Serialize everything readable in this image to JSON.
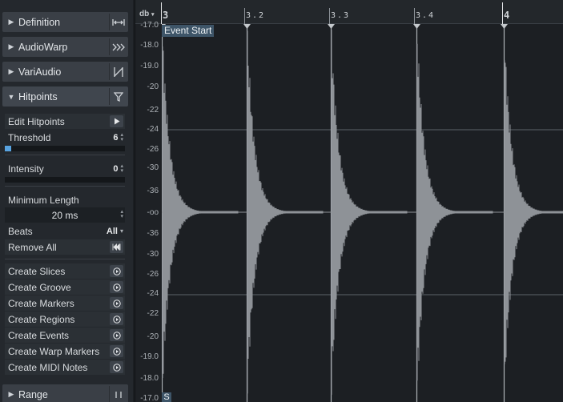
{
  "inspector": {
    "sections": [
      {
        "label": "Definition",
        "icon": "fit-width-icon",
        "expanded": false
      },
      {
        "label": "AudioWarp",
        "icon": "triple-chevron-icon",
        "expanded": false
      },
      {
        "label": "VariAudio",
        "icon": "variaudio-icon",
        "expanded": false
      },
      {
        "label": "Hitpoints",
        "icon": "filter-icon",
        "expanded": true
      },
      {
        "label": "Range",
        "icon": "range-bars-icon",
        "expanded": false
      }
    ],
    "hitpoints": {
      "edit_label": "Edit Hitpoints",
      "threshold_label": "Threshold",
      "threshold_value": "6",
      "threshold_level": 0.05,
      "intensity_label": "Intensity",
      "intensity_value": "0",
      "intensity_level": 0,
      "min_length_label": "Minimum Length",
      "min_length_value": "20 ms",
      "beats_label": "Beats",
      "beats_value": "All",
      "remove_all_label": "Remove All",
      "actions": [
        "Create Slices",
        "Create Groove",
        "Create Markers",
        "Create Regions",
        "Create Events",
        "Create Warp Markers",
        "Create MIDI Notes"
      ]
    }
  },
  "editor": {
    "db_unit": "db",
    "db_labels": [
      "-17.0",
      "-18.0",
      "-19.0",
      "-20",
      "-22",
      "-24",
      "-26",
      "-30",
      "-36",
      "-oo",
      "-36",
      "-30",
      "-26",
      "-24",
      "-22",
      "-20",
      "-19.0",
      "-18.0",
      "-17.0"
    ],
    "ruler_marks": [
      "3",
      "3.2",
      "3.3",
      "3.4",
      "4"
    ],
    "event_start_label": "Event Start",
    "s_marker_label": "S",
    "colors": {
      "waveform": "#8e9297",
      "marker_line": "#aeb3b8",
      "event_label_bg": "#3e5568",
      "accent": "#58a3e0"
    }
  }
}
